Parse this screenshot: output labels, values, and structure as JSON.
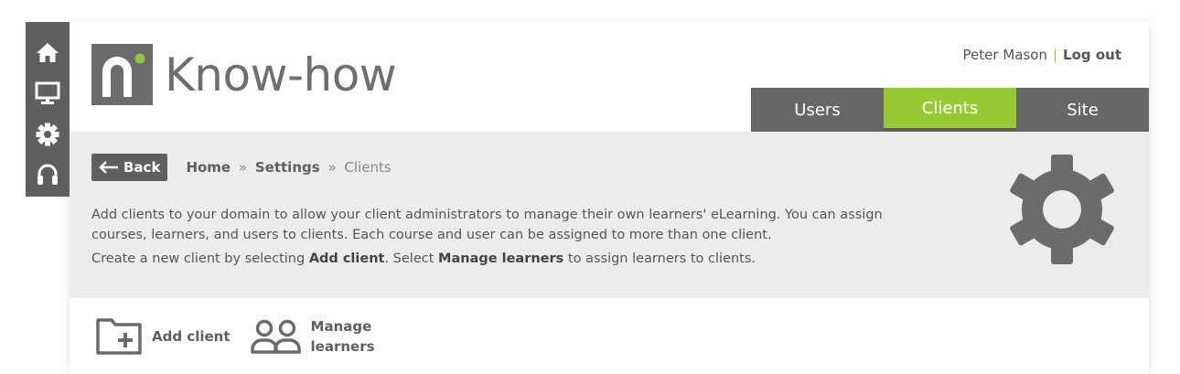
{
  "sidebar": {
    "icons": [
      "home-icon",
      "monitor-icon",
      "gear-icon",
      "headset-icon"
    ]
  },
  "brand": {
    "name": "Know-how",
    "accent_color": "#97c933",
    "dark_color": "#5f5f5f"
  },
  "user": {
    "name": "Peter Mason",
    "separator": "|",
    "logout_label": "Log out"
  },
  "tabs": [
    {
      "label": "Users",
      "active": false
    },
    {
      "label": "Clients",
      "active": true
    },
    {
      "label": "Site",
      "active": false
    }
  ],
  "banner": {
    "back_label": "Back",
    "breadcrumb": {
      "home": "Home",
      "settings": "Settings",
      "current": "Clients",
      "separator": "»"
    },
    "description": "Add clients to your domain to allow your client administrators to manage their own learners' eLearning. You can assign courses, learners, and users to clients. Each course and user can be assigned to more than one client.",
    "instruction_prefix": "Create a new client by selecting ",
    "instruction_add": "Add client",
    "instruction_mid": ". Select ",
    "instruction_manage": "Manage learners",
    "instruction_suffix": " to assign learners to clients."
  },
  "actions": {
    "add_client": "Add client",
    "manage_line1": "Manage",
    "manage_line2": "learners"
  }
}
